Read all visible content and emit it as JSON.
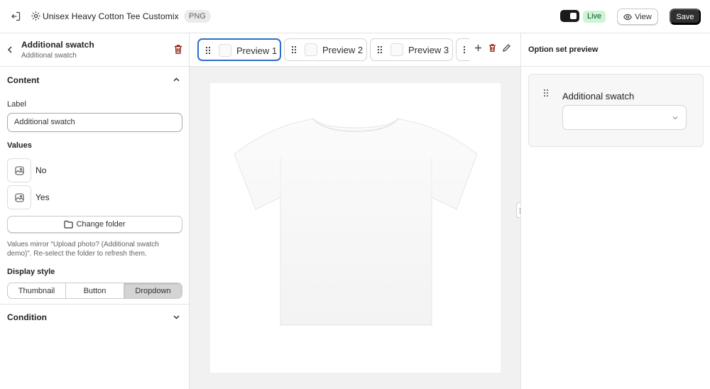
{
  "topbar": {
    "product_title": "Unisex Heavy Cotton Tee Customix",
    "file_badge": "PNG",
    "live_label": "Live",
    "view_label": "View",
    "save_label": "Save",
    "icons": [
      "exit-icon",
      "gear-icon",
      "eye-icon"
    ]
  },
  "left_panel": {
    "title": "Additional swatch",
    "subtitle": "Additional swatch",
    "content_section": {
      "title": "Content",
      "label_field": {
        "label": "Label",
        "value": "Additional swatch"
      },
      "values_heading": "Values",
      "values": [
        {
          "label": "No",
          "icon": "image-icon"
        },
        {
          "label": "Yes",
          "icon": "image-icon"
        }
      ],
      "change_folder_label": "Change folder",
      "help_text": "Values mirror “Upload photo? (Additional swatch demo)”. Re-select the folder to refresh them.",
      "display_style_heading": "Display style",
      "display_style_options": [
        "Thumbnail",
        "Button",
        "Dropdown"
      ],
      "display_style_selected": "Dropdown"
    },
    "condition_section": {
      "title": "Condition"
    }
  },
  "center": {
    "tabs": [
      {
        "label": "Preview 1",
        "active": true
      },
      {
        "label": "Preview 2",
        "active": false
      },
      {
        "label": "Preview 3",
        "active": false
      }
    ],
    "toolbar_icons": [
      "plus-icon",
      "trash-icon",
      "pencil-icon"
    ],
    "canvas_image": "white t-shirt mockup"
  },
  "right_panel": {
    "title": "Option set preview",
    "option": {
      "label": "Additional swatch",
      "selected_value": ""
    }
  },
  "colors": {
    "accent_blue": "#2c6ecb",
    "danger_red": "#8e1f0b",
    "live_green_bg": "#cdf5d3",
    "save_bg": "#303030"
  }
}
